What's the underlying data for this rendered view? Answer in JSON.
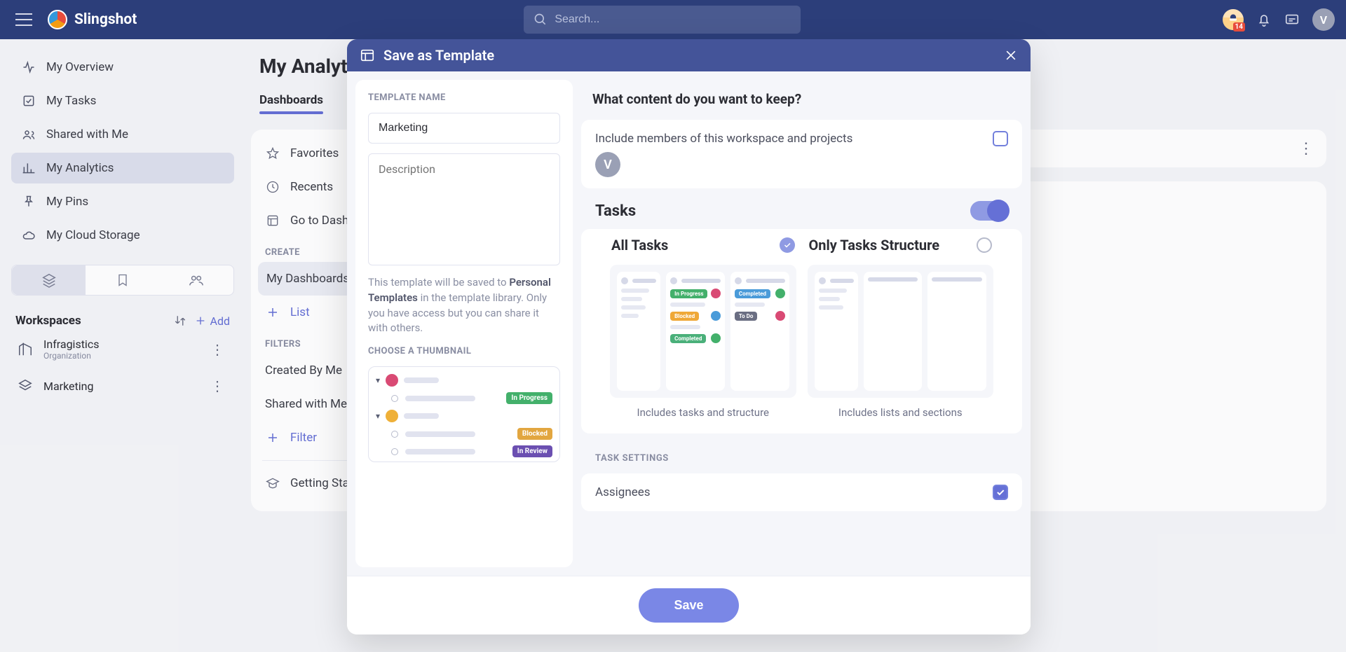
{
  "brand": "Slingshot",
  "search": {
    "placeholder": "Search..."
  },
  "topbar": {
    "badge": "14",
    "avatar_initial": "V"
  },
  "nav": {
    "items": [
      {
        "label": "My Overview"
      },
      {
        "label": "My Tasks"
      },
      {
        "label": "Shared with Me"
      },
      {
        "label": "My Analytics"
      },
      {
        "label": "My Pins"
      },
      {
        "label": "My Cloud Storage"
      }
    ],
    "workspaces_title": "Workspaces",
    "add_label": "Add",
    "ws": [
      {
        "name": "Infragistics",
        "sub": "Organization"
      },
      {
        "name": "Marketing",
        "sub": ""
      }
    ]
  },
  "page": {
    "title": "My Analytics",
    "tab_dashboards": "Dashboards",
    "section_create": "CREATE",
    "section_filters": "FILTERS",
    "items": {
      "favorites": "Favorites",
      "recents": "Recents",
      "goto": "Go to Dashboard",
      "mydash": "My Dashboards",
      "list": "List",
      "createdby": "Created By Me",
      "sharedwith": "Shared with Me",
      "filter": "Filter",
      "getting": "Getting Started"
    }
  },
  "modal": {
    "title": "Save as Template",
    "template_name_label": "TEMPLATE NAME",
    "name_value": "Marketing",
    "desc_placeholder": "Description",
    "help_pre": "This template will be saved to ",
    "help_bold": "Personal Templates",
    "help_post": " in the template library. Only you have access but you can share it with others.",
    "thumb_label": "CHOOSE A THUMBNAIL",
    "thumb_tags": {
      "inprogress": "In Progress",
      "blocked": "Blocked",
      "inreview": "In Review"
    },
    "question": "What content do you want to keep?",
    "include_members": "Include members of this workspace and projects",
    "member_initial": "V",
    "tasks_title": "Tasks",
    "opt_all": {
      "title": "All Tasks",
      "caption": "Includes tasks and structure"
    },
    "opt_struct": {
      "title": "Only Tasks Structure",
      "caption": "Includes lists and sections"
    },
    "task_settings_label": "TASK SETTINGS",
    "assignees": "Assignees",
    "save": "Save",
    "mini_tags": {
      "inprogress": "In Progress",
      "blocked": "Blocked",
      "completed": "Completed",
      "todo": "To Do"
    }
  }
}
